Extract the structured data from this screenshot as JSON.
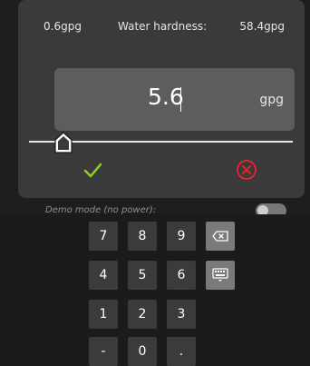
{
  "range": {
    "min_label": "0.6gpg",
    "title": "Water hardness:",
    "max_label": "58.4gpg"
  },
  "input": {
    "value": "5.6",
    "unit": "gpg"
  },
  "slider": {
    "min": 0.6,
    "max": 58.4,
    "value": 5.6
  },
  "actions": {
    "confirm_icon": "check-icon",
    "cancel_icon": "cancel-circle-icon",
    "confirm_color": "#8fd11b",
    "cancel_color": "#e2232a"
  },
  "demo": {
    "label": "Demo mode (no power):"
  },
  "keypad": {
    "rows": [
      [
        "7",
        "8",
        "9",
        "backspace-icon"
      ],
      [
        "4",
        "5",
        "6",
        "keyboard-icon"
      ],
      [
        "1",
        "2",
        "3"
      ],
      [
        "-",
        "0",
        "."
      ]
    ]
  }
}
